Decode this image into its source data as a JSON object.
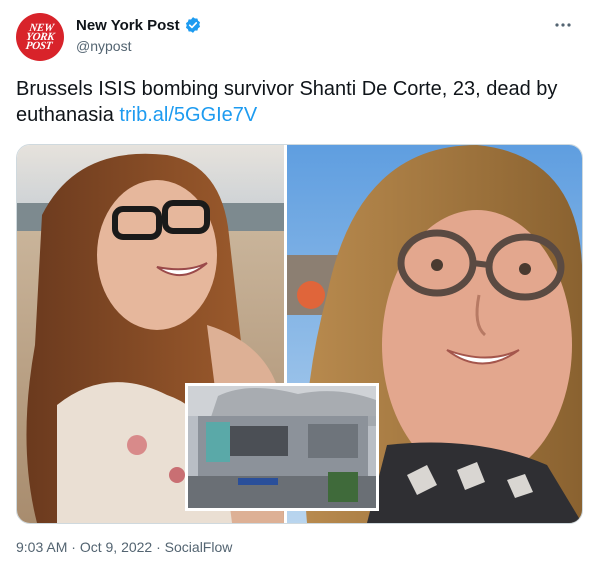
{
  "tweet": {
    "account": {
      "display_name": "New York Post",
      "handle": "@nypost",
      "avatar_logo_lines": [
        "NEW",
        "YORK",
        "POST"
      ],
      "verified_icon": "verified-badge-icon",
      "verified_color": "#1d9bf0"
    },
    "more_icon": "more-dots-icon",
    "text": "Brussels ISIS bombing survivor Shanti De Corte, 23, dead by euthanasia ",
    "link_text": "trib.al/5GGIe7V",
    "colors": {
      "link": "#1d9bf0",
      "brand_red": "#d8232a",
      "secondary_text": "#536471"
    },
    "media": {
      "photo_count": 3
    },
    "meta": {
      "time": "9:03 AM",
      "date": "Oct 9, 2022",
      "source": "SocialFlow",
      "separator": " · "
    }
  }
}
